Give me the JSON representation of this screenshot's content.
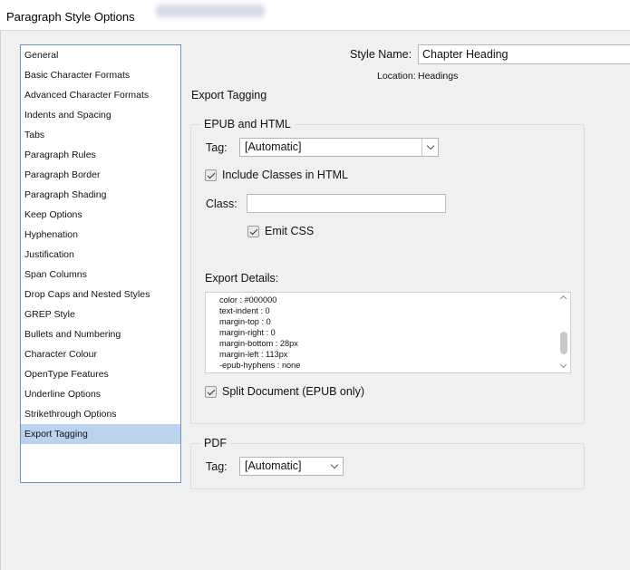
{
  "window": {
    "title": "Paragraph Style Options"
  },
  "sidebar": {
    "items": [
      "General",
      "Basic Character Formats",
      "Advanced Character Formats",
      "Indents and Spacing",
      "Tabs",
      "Paragraph Rules",
      "Paragraph Border",
      "Paragraph Shading",
      "Keep Options",
      "Hyphenation",
      "Justification",
      "Span Columns",
      "Drop Caps and Nested Styles",
      "GREP Style",
      "Bullets and Numbering",
      "Character Colour",
      "OpenType Features",
      "Underline Options",
      "Strikethrough Options",
      "Export Tagging"
    ],
    "selected": "Export Tagging"
  },
  "style": {
    "name_label": "Style Name:",
    "name_value": "Chapter Heading",
    "location_label": "Location:",
    "location_value": "Headings"
  },
  "section_title": "Export Tagging",
  "epub": {
    "group_title": "EPUB and HTML",
    "tag_label": "Tag:",
    "tag_value": "[Automatic]",
    "include_classes_label": "Include Classes in HTML",
    "include_classes_checked": true,
    "class_label": "Class:",
    "class_value": "",
    "emit_css_label": "Emit CSS",
    "emit_css_checked": true,
    "export_details_label": "Export Details:",
    "export_details_lines": [
      "color : #000000",
      "text-indent : 0",
      "margin-top : 0",
      "margin-right : 0",
      "margin-bottom : 28px",
      "margin-left : 113px",
      "-epub-hyphens : none"
    ],
    "split_document_label": "Split Document (EPUB only)",
    "split_document_checked": true
  },
  "pdf": {
    "group_title": "PDF",
    "tag_label": "Tag:",
    "tag_value": "[Automatic]"
  },
  "colors": {
    "selected_row": "#bcd3ee",
    "sidebar_border": "#6e93c0",
    "background": "#f0f0f0"
  }
}
